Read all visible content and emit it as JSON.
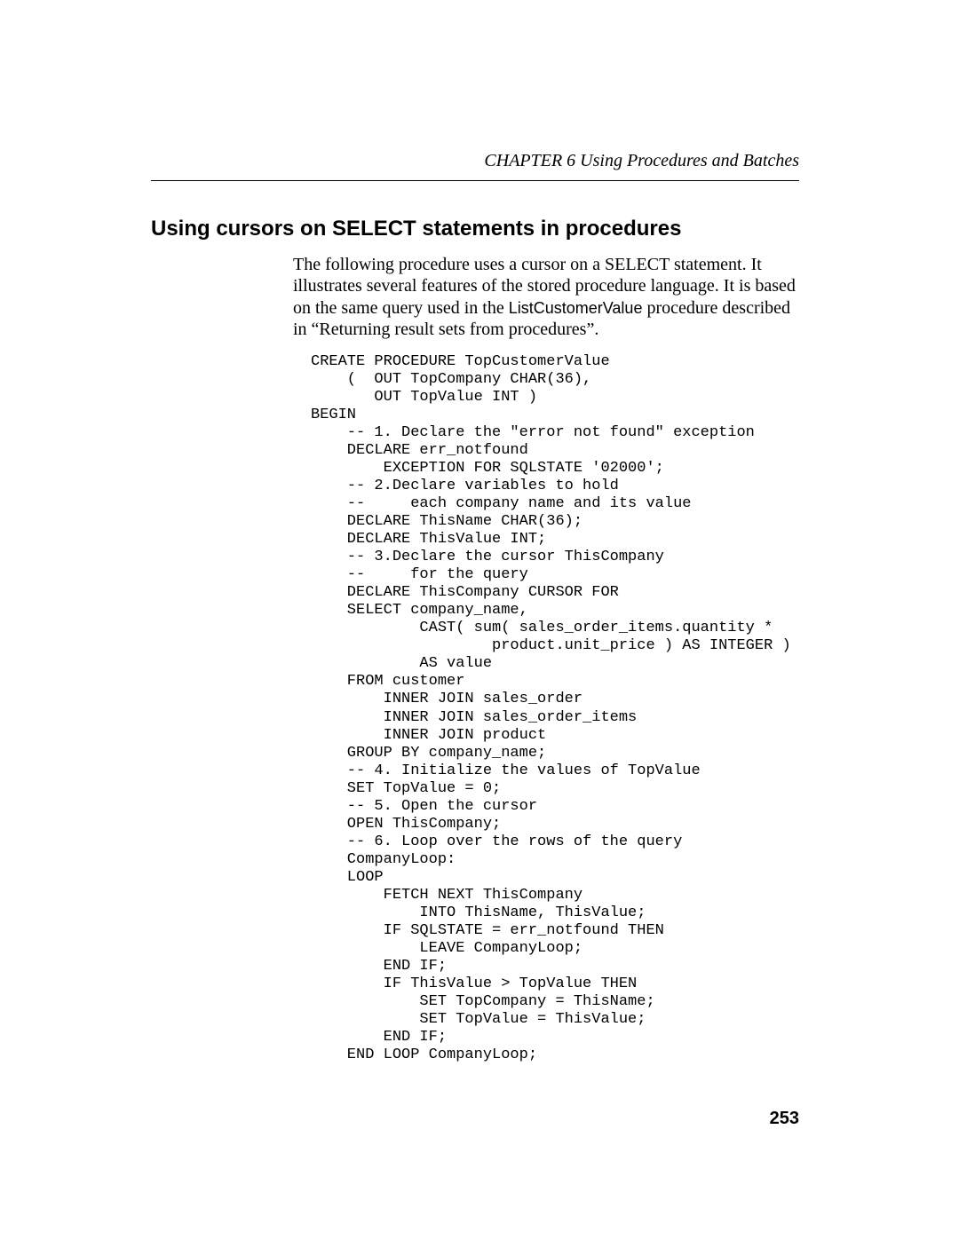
{
  "header": {
    "chapter": "CHAPTER 6    Using Procedures and Batches"
  },
  "section": {
    "title": "Using cursors on SELECT statements in procedures"
  },
  "paragraph": {
    "part1": "The following procedure uses a cursor on a SELECT statement. It illustrates several features of the stored procedure language. It is based on the same query used in the ",
    "inline_code": "ListCustomerValue",
    "part2": " procedure described in “Returning result sets from procedures”."
  },
  "code": "CREATE PROCEDURE TopCustomerValue\n    (  OUT TopCompany CHAR(36),\n       OUT TopValue INT )\nBEGIN\n    -- 1. Declare the \"error not found\" exception\n    DECLARE err_notfound\n        EXCEPTION FOR SQLSTATE '02000';\n    -- 2.Declare variables to hold\n    --     each company name and its value\n    DECLARE ThisName CHAR(36);\n    DECLARE ThisValue INT;\n    -- 3.Declare the cursor ThisCompany\n    --     for the query\n    DECLARE ThisCompany CURSOR FOR\n    SELECT company_name,\n            CAST( sum( sales_order_items.quantity *\n                    product.unit_price ) AS INTEGER )\n            AS value\n    FROM customer\n        INNER JOIN sales_order\n        INNER JOIN sales_order_items\n        INNER JOIN product\n    GROUP BY company_name;\n    -- 4. Initialize the values of TopValue\n    SET TopValue = 0;\n    -- 5. Open the cursor\n    OPEN ThisCompany;\n    -- 6. Loop over the rows of the query\n    CompanyLoop:\n    LOOP\n        FETCH NEXT ThisCompany\n            INTO ThisName, ThisValue;\n        IF SQLSTATE = err_notfound THEN\n            LEAVE CompanyLoop;\n        END IF;\n        IF ThisValue > TopValue THEN\n            SET TopCompany = ThisName;\n            SET TopValue = ThisValue;\n        END IF;\n    END LOOP CompanyLoop;",
  "page_number": "253"
}
